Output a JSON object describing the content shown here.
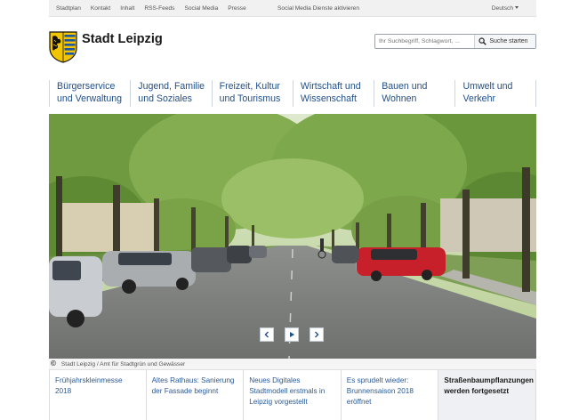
{
  "topbar": {
    "links": [
      "Stadtplan",
      "Kontakt",
      "Inhalt",
      "RSS-Feeds",
      "Social Media",
      "Presse"
    ],
    "social_media_activate": "Social Media Dienste aktivieren",
    "language": "Deutsch"
  },
  "header": {
    "brand": "Stadt Leipzig"
  },
  "search": {
    "placeholder": "Ihr Suchbegriff, Schlagwort, ...",
    "button_label": "Suche starten"
  },
  "nav": {
    "items": [
      {
        "line1": "Bürgerservice",
        "line2": "und Verwaltung"
      },
      {
        "line1": "Jugend, Familie",
        "line2": "und Soziales"
      },
      {
        "line1": "Freizeit, Kultur",
        "line2": "und Tourismus"
      },
      {
        "line1": "Wirtschaft und",
        "line2": "Wissenschaft"
      },
      {
        "line1": "Bauen und",
        "line2": "Wohnen"
      },
      {
        "line1": "Umwelt und",
        "line2": "Verkehr"
      }
    ]
  },
  "hero": {
    "credit_symbol": "©",
    "credit": "Stadt Leipzig / Amt für Stadtgrün und Gewässer"
  },
  "news": {
    "tabs": [
      {
        "line1": "Frühjahrskleinmesse",
        "line2": "2018",
        "line3": ""
      },
      {
        "line1": "Altes Rathaus: Sanierung",
        "line2": "der Fassade beginnt",
        "line3": ""
      },
      {
        "line1": "Neues Digitales",
        "line2": "Stadtmodell erstmals in",
        "line3": "Leipzig vorgestellt"
      },
      {
        "line1": "Es sprudelt wieder:",
        "line2": "Brunnensaison 2018",
        "line3": "eröffnet"
      },
      {
        "line1": "Straßenbaumpflanzungen",
        "line2": "werden fortgesetzt",
        "line3": ""
      }
    ]
  },
  "colors": {
    "nav_text": "#1f4f8b",
    "news_link": "#2a5a96",
    "logo_yellow": "#f2c500"
  }
}
